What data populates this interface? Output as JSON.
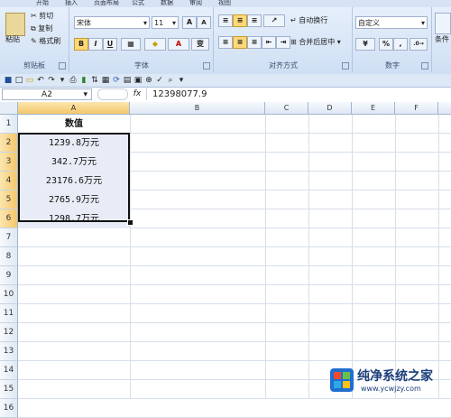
{
  "ribbon": {
    "tabs": [
      "开始",
      "插入",
      "页面布局",
      "公式",
      "数据",
      "审阅",
      "视图"
    ],
    "clipboard": {
      "paste": "粘贴",
      "cut": "剪切",
      "copy": "复制",
      "format_painter": "格式刷",
      "label": "剪贴板"
    },
    "font": {
      "name": "宋体",
      "size": "11",
      "grow": "A",
      "shrink": "A",
      "bold": "B",
      "italic": "I",
      "underline": "U",
      "font_color": "A",
      "wen": "变",
      "label": "字体"
    },
    "alignment": {
      "wrap_text": "自动换行",
      "merge_center": "合并后居中",
      "label": "对齐方式"
    },
    "number": {
      "format": "自定义",
      "percent": "%",
      "comma": ",",
      "label": "数字"
    },
    "styles": {
      "conditional": "条件"
    }
  },
  "formula_bar": {
    "name_box": "A2",
    "fx": "fx",
    "value": "12398077.9"
  },
  "columns": [
    "A",
    "B",
    "C",
    "D",
    "E",
    "F"
  ],
  "rows": [
    "1",
    "2",
    "3",
    "4",
    "5",
    "6",
    "7",
    "8",
    "9",
    "10",
    "11",
    "12",
    "13",
    "14",
    "15",
    "16"
  ],
  "cells": {
    "A1": "数值",
    "A2": "1239.8万元",
    "A3": "342.7万元",
    "A4": "23176.6万元",
    "A5": "2765.9万元",
    "A6": "1298.7万元"
  },
  "watermark": {
    "text": "纯净系统之家",
    "url": "www.ycwjzy.com"
  },
  "colors": {
    "selection_border": "#111111",
    "header_selected": "#f5c66a",
    "ribbon": "#cfdff3"
  }
}
